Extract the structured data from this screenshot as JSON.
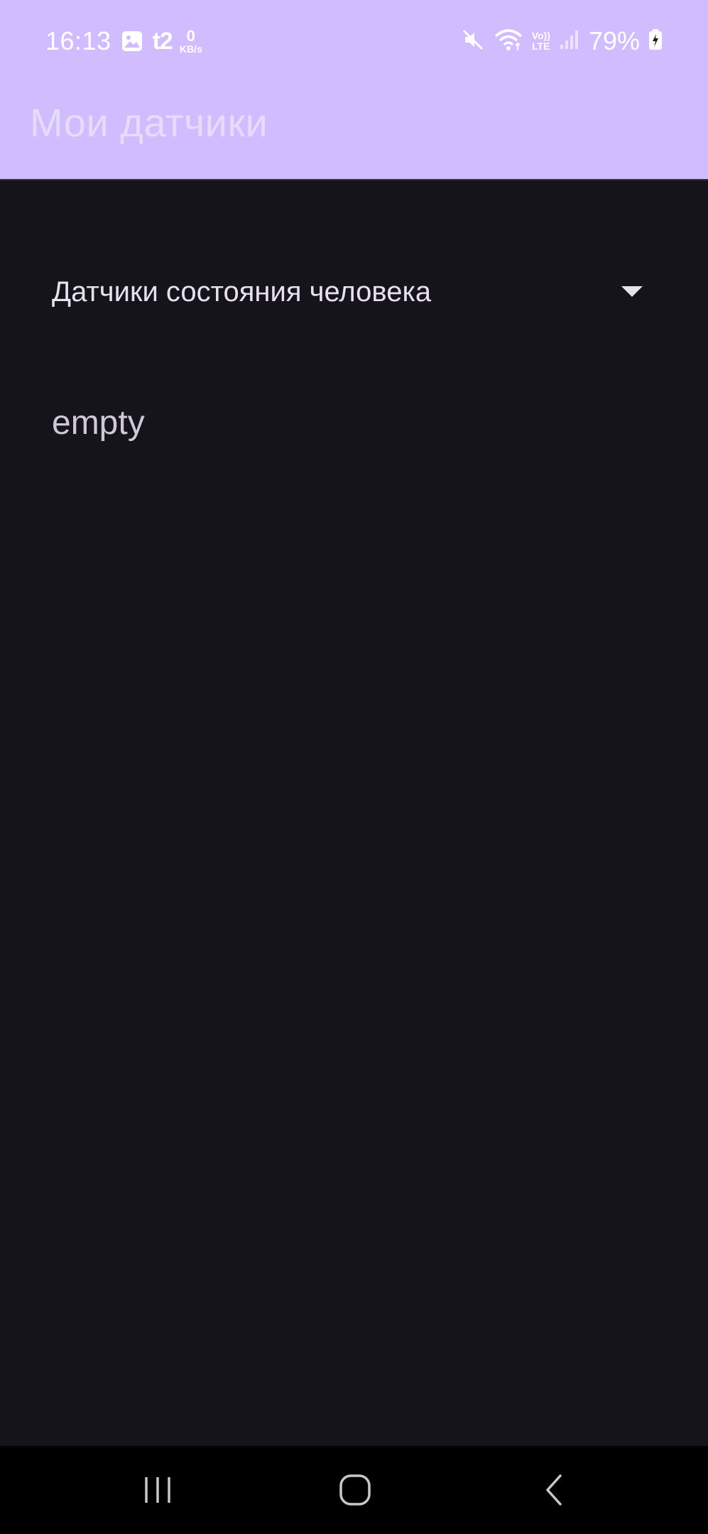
{
  "status_bar": {
    "time": "16:13",
    "carrier": "t2",
    "net_speed_value": "0",
    "net_speed_unit": "KB/s",
    "volte_top": "Vo))",
    "volte_bottom": "LTE",
    "battery_percent": "79%",
    "background_color": "#d0bcfe"
  },
  "app_bar": {
    "title": "Мои датчики"
  },
  "sensor_dropdown": {
    "selected": "Датчики состояния человека"
  },
  "content": {
    "empty_text": "empty"
  },
  "nav_bar": {
    "icons": [
      "recent-apps-icon",
      "home-icon",
      "back-icon"
    ]
  }
}
